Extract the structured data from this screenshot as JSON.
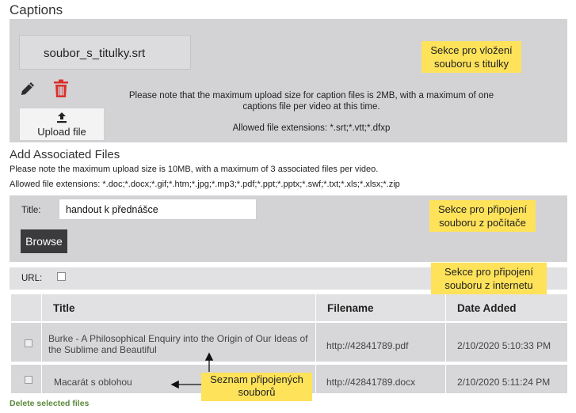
{
  "captions": {
    "heading": "Captions",
    "file_name": "soubor_s_titulky.srt",
    "upload_label": "Upload file",
    "note_line1": "Please note that the maximum upload size for caption files is 2MB, with a maximum of one",
    "note_line2": "captions file per video at this time.",
    "extensions": "Allowed file extensions: *.srt;*.vtt;*.dfxp",
    "callout_line1": "Sekce pro vložení",
    "callout_line2": "souboru s titulky"
  },
  "associated": {
    "heading": "Add Associated Files",
    "note": "Please note the maximum upload size is 10MB, with a maximum of 3 associated files per video.",
    "extensions": "Allowed file extensions: *.doc;*.docx;*.gif;*.htm;*.jpg;*.mp3;*.pdf;*.ppt;*.pptx;*.swf;*.txt;*.xls;*.xlsx;*.zip",
    "title_label": "Title:",
    "title_value": "handout k přednášce",
    "browse_label": "Browse",
    "callout_computer_line1": "Sekce pro připojení",
    "callout_computer_line2": "souboru z počítače",
    "url_label": "URL:",
    "callout_internet_line1": "Sekce pro připojení",
    "callout_internet_line2": "souboru z internetu"
  },
  "table": {
    "headers": [
      "Title",
      "Filename",
      "Date Added"
    ],
    "rows": [
      {
        "title": "Burke - A Philosophical Enquiry into the Origin of Our Ideas of the Sublime and Beautiful",
        "filename": "http://42841789.pdf",
        "date": "2/10/2020 5:10:33 PM"
      },
      {
        "title": "Macarát s oblohou",
        "filename": "http://42841789.docx",
        "date": "2/10/2020 5:11:24 PM"
      }
    ],
    "callout_line1": "Seznam připojených",
    "callout_line2": "souborů",
    "delete_label": "Delete selected files"
  },
  "colors": {
    "callout": "#fee25a",
    "trash": "#d9302c",
    "panel": "#d3d3d6",
    "delete_link": "#5a8a3a"
  }
}
